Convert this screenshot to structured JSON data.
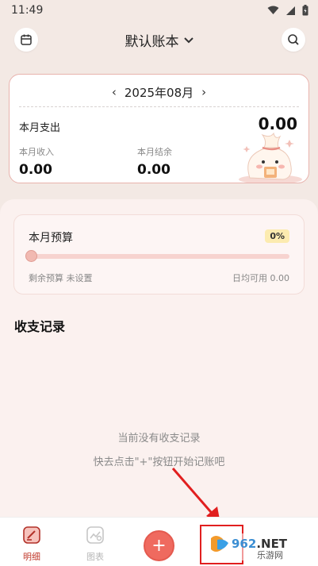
{
  "status_bar": {
    "time": "11:49"
  },
  "header": {
    "title": "默认账本",
    "calendar_icon": "calendar-icon",
    "search_icon": "search-icon"
  },
  "summary": {
    "month": "2025年08月",
    "expense_label": "本月支出",
    "expense_value": "0.00",
    "income_label": "本月收入",
    "income_value": "0.00",
    "balance_label": "本月结余",
    "balance_value": "0.00"
  },
  "budget": {
    "title": "本月预算",
    "percent": "0%",
    "progress": 0,
    "remaining": "剩余预算 未设置",
    "daily": "日均可用 0.00"
  },
  "records": {
    "title": "收支记录",
    "empty_line1": "当前没有收支记录",
    "empty_line2": "快去点击\"+\"按钮开始记账吧"
  },
  "bottom_nav": {
    "detail_label": "明细",
    "chart_label": "图表",
    "add_label": "+"
  },
  "watermark": {
    "brand": "962.NET",
    "sub": "乐游网"
  },
  "colors": {
    "accent": "#ef6a5f",
    "card_border": "#e8b3ad",
    "badge_bg": "#fcebb0",
    "annotation": "#e11f1f"
  }
}
